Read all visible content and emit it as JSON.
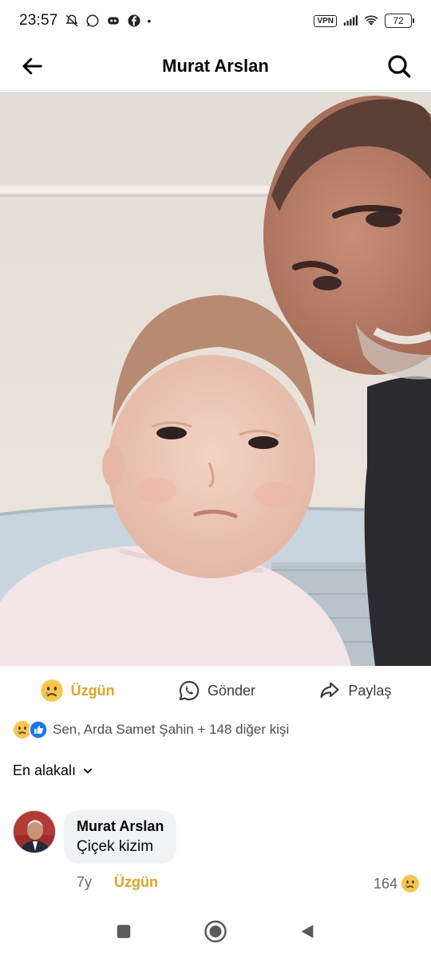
{
  "status_bar": {
    "time": "23:57",
    "icons_left": [
      "mute-bell-icon",
      "whatsapp-icon",
      "vpn-key-icon",
      "facebook-icon"
    ],
    "dot": "•",
    "vpn_label": "VPN",
    "battery": "72"
  },
  "header": {
    "title": "Murat Arslan"
  },
  "action_bar": {
    "react_label": "Üzgün",
    "send_label": "Gönder",
    "share_label": "Paylaş"
  },
  "reactions_summary": {
    "text": "Sen, Arda Samet Şahin + 148 diğer kişi"
  },
  "comments_sort": {
    "label": "En alakalı"
  },
  "comment": {
    "author": "Murat Arslan",
    "text": "Çiçek kizim",
    "age": "7y",
    "reaction_label": "Üzgün",
    "reaction_count": "164"
  },
  "colors": {
    "sad_accent": "#e8a21e",
    "like_blue": "#1877f2",
    "bubble_bg": "#f0f2f5",
    "secondary_text": "#65676b"
  }
}
